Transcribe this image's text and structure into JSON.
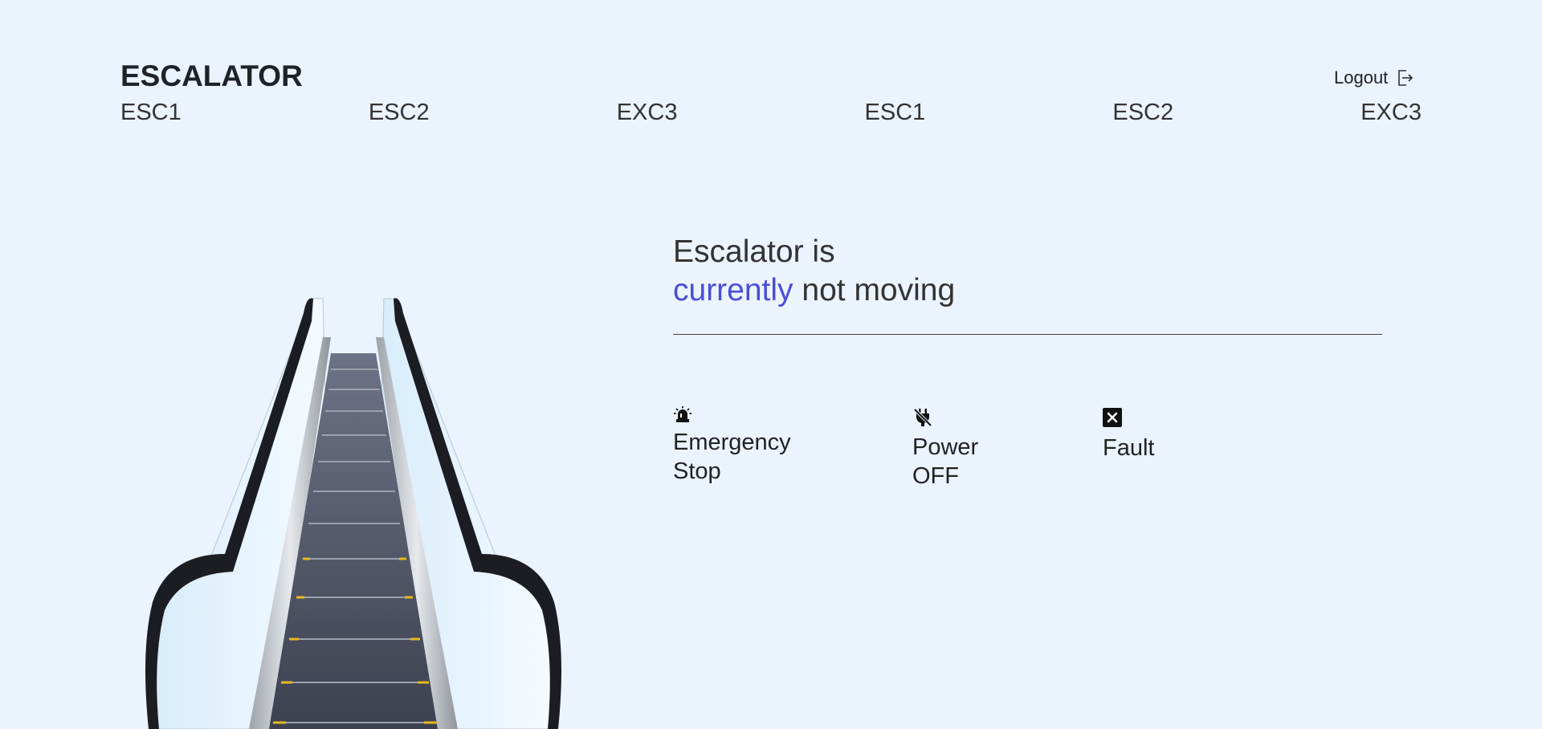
{
  "header": {
    "brand": "ESCALATOR",
    "logout_label": "Logout"
  },
  "nav": {
    "items": [
      "ESC1",
      "ESC2",
      "EXC3",
      "ESC1",
      "ESC2",
      "EXC3"
    ]
  },
  "main": {
    "headline_line1": "Escalator is",
    "headline_accent": "currently",
    "headline_rest": "not moving",
    "accent_color": "#4a4ed6"
  },
  "statuses": [
    {
      "icon": "siren-icon",
      "line1": "Emergency",
      "line2": "Stop"
    },
    {
      "icon": "power-off-icon",
      "line1": "Power",
      "line2": "OFF"
    },
    {
      "icon": "fault-x-icon",
      "line1": "Fault",
      "line2": ""
    }
  ],
  "illustration": {
    "icon": "escalator-illustration"
  }
}
